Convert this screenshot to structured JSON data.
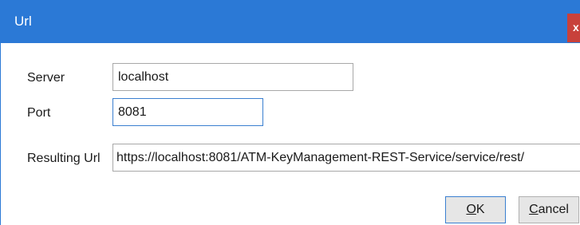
{
  "window": {
    "title": "Url",
    "close_glyph": "x"
  },
  "form": {
    "server": {
      "label": "Server",
      "value": "localhost"
    },
    "port": {
      "label": "Port",
      "value": "8081"
    },
    "resulting_url": {
      "label": "Resulting Url",
      "value": "https://localhost:8081/ATM-KeyManagement-REST-Service/service/rest/"
    }
  },
  "buttons": {
    "ok": {
      "mnemonic": "O",
      "rest": "K"
    },
    "cancel": {
      "mnemonic": "C",
      "rest": "ancel"
    }
  },
  "colors": {
    "titlebar": "#2b79d6",
    "close_button": "#c8413b",
    "focus_border": "#3a7fd0"
  }
}
